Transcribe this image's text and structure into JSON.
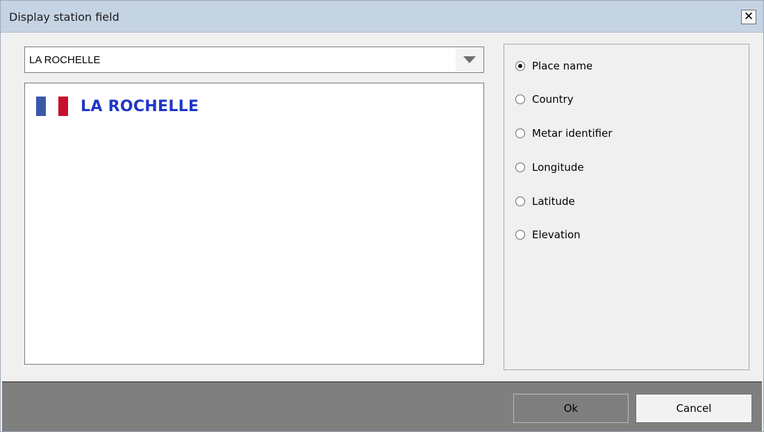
{
  "window": {
    "title": "Display station field",
    "close_label": "✕"
  },
  "combo": {
    "value": "LA ROCHELLE"
  },
  "list": {
    "items": [
      {
        "flag": "france-flag",
        "label": "LA ROCHELLE"
      }
    ]
  },
  "options": {
    "selected": "Place name",
    "items": [
      {
        "label": "Place name",
        "checked": true
      },
      {
        "label": "Country",
        "checked": false
      },
      {
        "label": "Metar identifier",
        "checked": false
      },
      {
        "label": "Longitude",
        "checked": false
      },
      {
        "label": "Latitude",
        "checked": false
      },
      {
        "label": "Elevation",
        "checked": false
      }
    ]
  },
  "footer": {
    "ok_label": "Ok",
    "cancel_label": "Cancel"
  },
  "colors": {
    "station_name": "#2037c6",
    "titlebar": "#c5d4e3",
    "footer": "#7f7f7f",
    "flag_blue": "#3a58a8",
    "flag_red": "#c8102e"
  }
}
